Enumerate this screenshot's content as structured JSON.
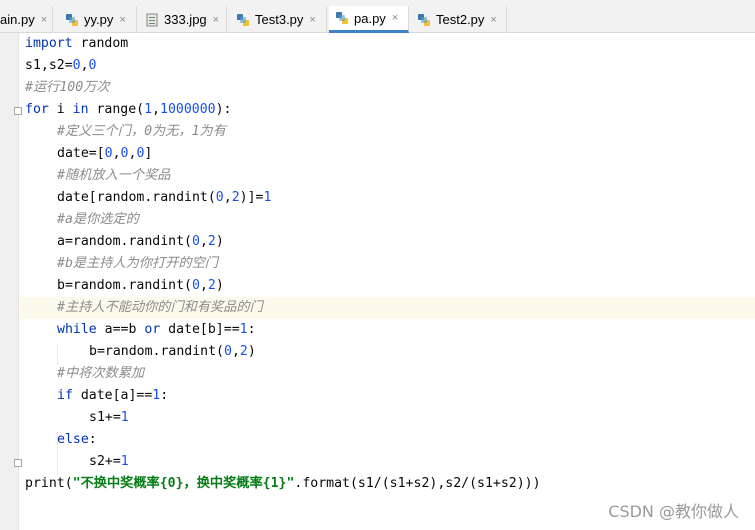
{
  "tabs": [
    {
      "label": "ain.py",
      "icon": "python-file-icon"
    },
    {
      "label": "yy.py",
      "icon": "python-file-icon"
    },
    {
      "label": "333.jpg",
      "icon": "image-file-icon"
    },
    {
      "label": "Test3.py",
      "icon": "python-file-icon"
    },
    {
      "label": "pa.py",
      "icon": "python-file-icon",
      "active": true
    },
    {
      "label": "Test2.py",
      "icon": "python-file-icon"
    }
  ],
  "tab_close_glyph": "×",
  "code": {
    "l1": {
      "a": "import",
      "b": " random"
    },
    "l2": {
      "a": "s1,s2=",
      "b": "0",
      "c": ",",
      "d": "0"
    },
    "l3": {
      "a": "#运行100万次"
    },
    "l4": {
      "a": "for",
      "b": " i ",
      "c": "in",
      "d": " range(",
      "e": "1",
      "f": ",",
      "g": "1000000",
      "h": "):"
    },
    "l5": {
      "a": "#定义三个门，0为无，1为有"
    },
    "l6": {
      "a": "date=[",
      "b": "0",
      "c": ",",
      "d": "0",
      "e": ",",
      "f": "0",
      "g": "]"
    },
    "l7": {
      "a": "#随机放入一个奖品"
    },
    "l8": {
      "a": "date[random.randint(",
      "b": "0",
      "c": ",",
      "d": "2",
      "e": ")]=",
      "f": "1"
    },
    "l9": {
      "a": "#a是你选定的"
    },
    "l10": {
      "a": "a=random.randint(",
      "b": "0",
      "c": ",",
      "d": "2",
      "e": ")"
    },
    "l11": {
      "a": "#b是主持人为你打开的空门"
    },
    "l12": {
      "a": "b=random.randint(",
      "b": "0",
      "c": ",",
      "d": "2",
      "e": ")"
    },
    "l13": {
      "a": "#主持人不能动你的门和有奖品的门"
    },
    "l14": {
      "a": "while",
      "b": " a==b ",
      "c": "or",
      "d": " date[b]==",
      "e": "1",
      "f": ":"
    },
    "l15": {
      "a": "b=random.randint(",
      "b": "0",
      "c": ",",
      "d": "2",
      "e": ")"
    },
    "l16": {
      "a": "#中将次数累加"
    },
    "l17": {
      "a": "if",
      "b": " date[a]==",
      "c": "1",
      "d": ":"
    },
    "l18": {
      "a": "s1+=",
      "b": "1"
    },
    "l19": {
      "a": "else",
      "b": ":"
    },
    "l20": {
      "a": "s2+=",
      "b": "1"
    },
    "l21": {
      "a": "print(",
      "b": "\"不换中奖概率{0}，换中奖概率{1}\"",
      "c": ".format(s1/(s1+s2),s2/(s1+s2)))"
    }
  },
  "watermark": "CSDN @教你做人",
  "colors": {
    "keyword": "#0033b3",
    "number": "#1750eb",
    "comment": "#8c8c8c",
    "string": "#067d17",
    "active_tab_underline": "#4083c9",
    "current_line": "#fcfaed"
  }
}
